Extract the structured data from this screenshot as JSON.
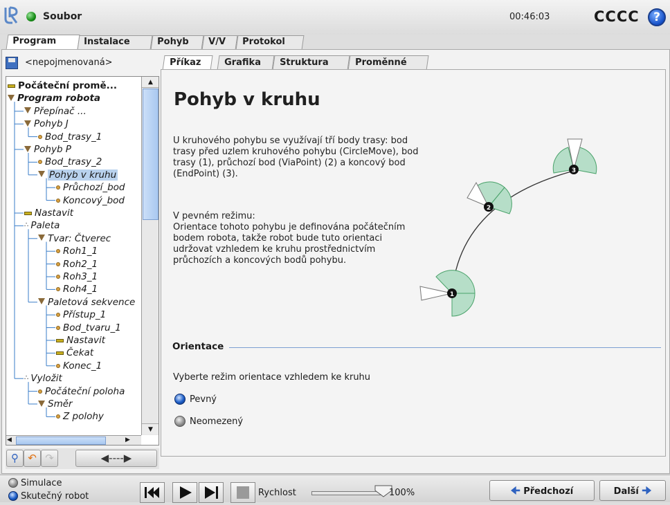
{
  "topbar": {
    "file_menu": "Soubor",
    "clock": "00:46:03",
    "robot_name": "CCCC",
    "help_label": "?"
  },
  "main_tabs": [
    {
      "label": "Program",
      "active": true
    },
    {
      "label": "Instalace",
      "active": false
    },
    {
      "label": "Pohyb",
      "active": false
    },
    {
      "label": "V/V",
      "active": false
    },
    {
      "label": "Protokol",
      "active": false
    }
  ],
  "program": {
    "name": "<nepojmenovaná>"
  },
  "tree": [
    {
      "label": "Počáteční promě...",
      "icon": "bar",
      "depth": 0,
      "bold": true,
      "plain": true
    },
    {
      "label": "Program robota",
      "icon": "triangle",
      "depth": 0,
      "bold": true
    },
    {
      "label": "Přepínač ...",
      "icon": "triangle",
      "depth": 1
    },
    {
      "label": "Pohyb J",
      "icon": "triangle",
      "depth": 1
    },
    {
      "label": "Bod_trasy_1",
      "icon": "waypoint",
      "depth": 2
    },
    {
      "label": "Pohyb P",
      "icon": "triangle",
      "depth": 1
    },
    {
      "label": "Bod_trasy_2",
      "icon": "waypoint",
      "depth": 2
    },
    {
      "label": "Pohyb v kruhu",
      "icon": "triangle",
      "depth": 2,
      "selected": true
    },
    {
      "label": "Průchozí_bod",
      "icon": "waypoint",
      "depth": 3
    },
    {
      "label": "Koncový_bod",
      "icon": "waypoint",
      "depth": 3
    },
    {
      "label": "Nastavit",
      "icon": "bar",
      "depth": 1
    },
    {
      "label": "Paleta",
      "icon": "pallet",
      "depth": 1
    },
    {
      "label": "Tvar: Čtverec",
      "icon": "triangle",
      "depth": 2
    },
    {
      "label": "Roh1_1",
      "icon": "waypoint",
      "depth": 3
    },
    {
      "label": "Roh2_1",
      "icon": "waypoint",
      "depth": 3
    },
    {
      "label": "Roh3_1",
      "icon": "waypoint",
      "depth": 3
    },
    {
      "label": "Roh4_1",
      "icon": "waypoint",
      "depth": 3
    },
    {
      "label": "Paletová sekvence",
      "icon": "triangle",
      "depth": 2
    },
    {
      "label": "Přístup_1",
      "icon": "waypoint",
      "depth": 3
    },
    {
      "label": "Bod_tvaru_1",
      "icon": "waypoint",
      "depth": 3
    },
    {
      "label": "Nastavit",
      "icon": "bar",
      "depth": 3
    },
    {
      "label": "Čekat",
      "icon": "bar",
      "depth": 3
    },
    {
      "label": "Konec_1",
      "icon": "waypoint",
      "depth": 3
    },
    {
      "label": "Vyložit",
      "icon": "pallet",
      "depth": 1
    },
    {
      "label": "Počáteční poloha",
      "icon": "waypoint",
      "depth": 2
    },
    {
      "label": "Směr",
      "icon": "triangle",
      "depth": 2
    },
    {
      "label": "Z polohy",
      "icon": "waypoint",
      "depth": 3
    }
  ],
  "sub_tabs": [
    {
      "label": "Příkaz",
      "active": true
    },
    {
      "label": "Grafika",
      "active": false
    },
    {
      "label": "Struktura",
      "active": false
    },
    {
      "label": "Proměnné",
      "active": false
    }
  ],
  "panel": {
    "title": "Pohyb v kruhu",
    "desc1": "U kruhového pohybu se využívají tří body trasy: bod trasy před uzlem kruhového pohybu (CircleMove), bod trasy (1), průchozí bod (ViaPoint) (2) a koncový bod (EndPoint) (3).",
    "desc2": "V pevném režimu:\nOrientace tohoto pohybu je definována počátečním bodem robota, takže robot bude tuto orientaci udržovat vzhledem ke kruhu prostřednictvím průchozích a koncových bodů pohybu.",
    "diagram_points": [
      "1",
      "2",
      "3"
    ],
    "orientation_title": "Orientace",
    "orientation_prompt": "Vyberte režim orientace vzhledem ke kruhu",
    "options": [
      {
        "label": "Pevný",
        "selected": true
      },
      {
        "label": "Neomezený",
        "selected": false
      }
    ]
  },
  "bottom": {
    "modes": [
      {
        "label": "Simulace",
        "selected": false
      },
      {
        "label": "Skutečný robot",
        "selected": true
      }
    ],
    "speed_label": "Rychlost",
    "speed_value": "100%",
    "speed_fraction": 1.0,
    "prev_label": "Předchozí",
    "next_label": "Další"
  },
  "colors": {
    "accent": "#2f62c0",
    "selection": "#b9d2ee",
    "arc_fill": "#b6dec8"
  }
}
